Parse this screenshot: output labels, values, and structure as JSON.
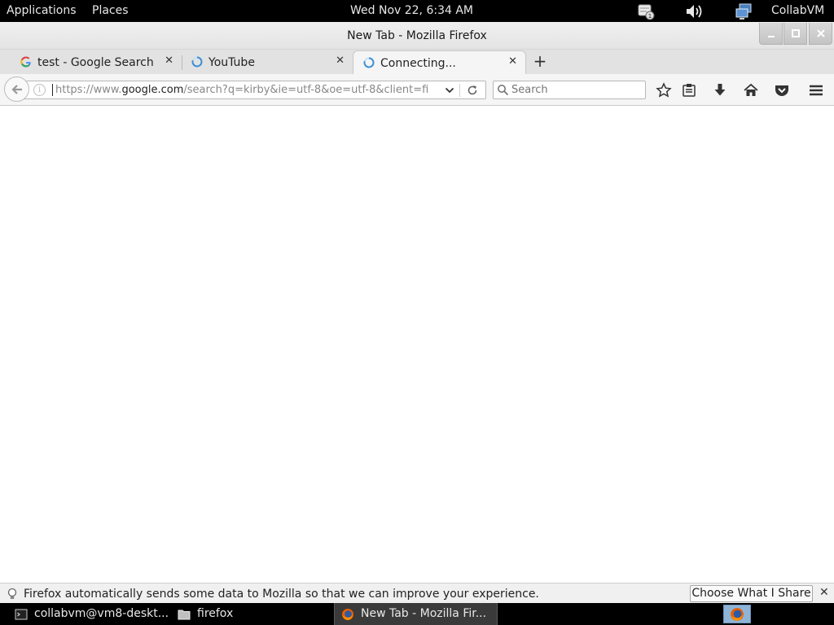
{
  "top_panel": {
    "applications": "Applications",
    "places": "Places",
    "clock": "Wed Nov 22,  6:34 AM",
    "user": "CollabVM",
    "icons": [
      "notification-icon",
      "volume-icon",
      "network-icon"
    ]
  },
  "window": {
    "title": "New Tab - Mozilla Firefox"
  },
  "tabs": [
    {
      "label": "test - Google Search",
      "favicon": "google-icon"
    },
    {
      "label": "YouTube",
      "favicon": "loading-spinner-icon"
    },
    {
      "label": "Connecting...",
      "favicon": "loading-spinner-icon",
      "active": true
    }
  ],
  "navbar": {
    "url_prefix": "https://www.",
    "url_host": "google.com",
    "url_rest": "/search?q=kirby&ie=utf-8&oe=utf-8&client=fi",
    "search_placeholder": "Search"
  },
  "notification": {
    "text": "Firefox automatically sends some data to Mozilla so that we can improve your experience.",
    "button": "Choose What I Share",
    "close": "✕"
  },
  "taskbar": {
    "items": [
      {
        "label": "collabvm@vm8-deskt...",
        "icon": "terminal-icon"
      },
      {
        "label": "firefox",
        "icon": "folder-icon"
      },
      {
        "label": "New Tab - Mozilla Fir...",
        "icon": "firefox-icon",
        "active": true
      }
    ]
  },
  "colors": {
    "panel_bg": "#000000",
    "toolbar_bg": "#f5f5f5",
    "spinner_blue": "#3b8fd6"
  }
}
